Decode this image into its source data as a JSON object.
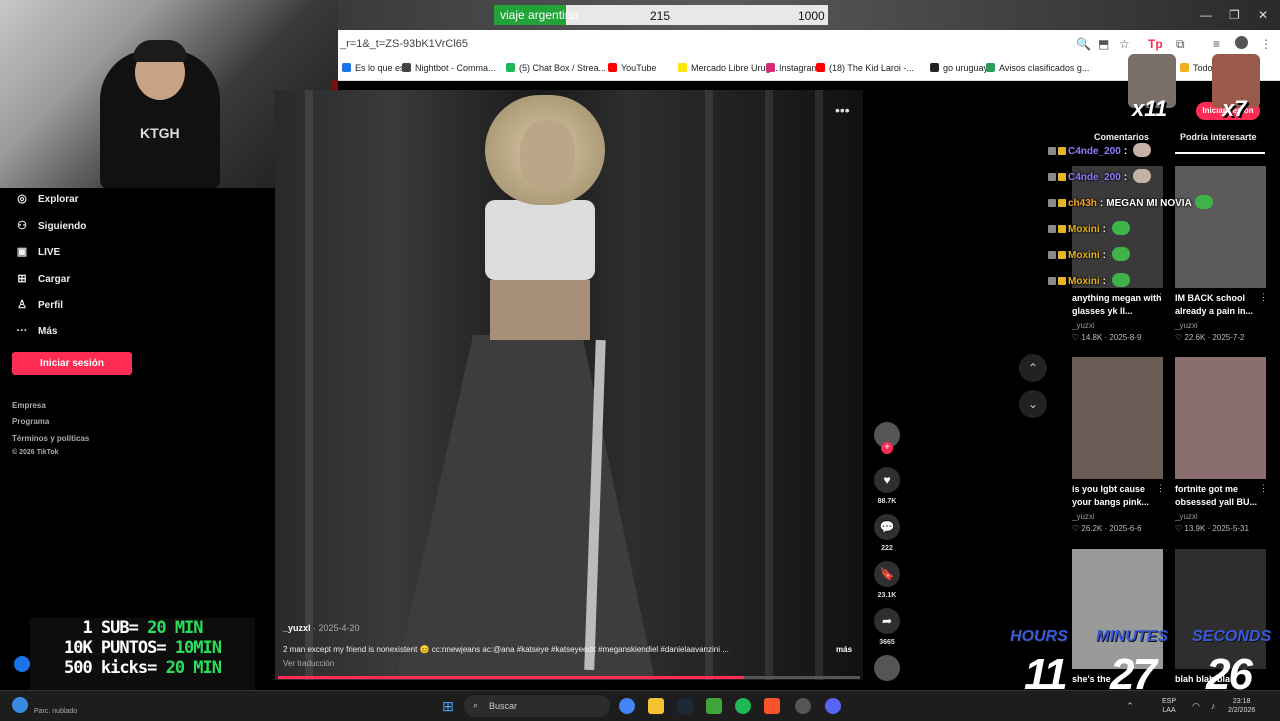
{
  "goal": {
    "label": "viaje argentina",
    "current": "215",
    "target": "1000",
    "progress": 0.215
  },
  "address": {
    "url": "_r=1&_t=ZS-93bK1VrCl65"
  },
  "bookmarks": [
    {
      "label": "Es lo que es...",
      "color": "#1a73e8"
    },
    {
      "label": "Nightbot - Comma...",
      "color": "#444"
    },
    {
      "label": "(5) Chat Box / Strea...",
      "color": "#1db954"
    },
    {
      "label": "YouTube",
      "color": "#ff0000"
    },
    {
      "label": "Mercado Libre Urug...",
      "color": "#ffe600"
    },
    {
      "label": "Instagram",
      "color": "#d62976"
    },
    {
      "label": "(18) The Kid Laroi -...",
      "color": "#ff0000"
    },
    {
      "label": "go uruguay",
      "color": "#222"
    },
    {
      "label": "Avisos clasificados g...",
      "color": "#2a9d5c"
    },
    {
      "label": "Todos",
      "color": "#f2b01e"
    }
  ],
  "sidebar": {
    "items": [
      {
        "label": "Explorar",
        "icon": "compass-icon"
      },
      {
        "label": "Siguiendo",
        "icon": "user-follow-icon"
      },
      {
        "label": "LIVE",
        "icon": "live-icon"
      },
      {
        "label": "Cargar",
        "icon": "upload-icon"
      },
      {
        "label": "Perfil",
        "icon": "profile-icon"
      },
      {
        "label": "Más",
        "icon": "more-icon"
      }
    ],
    "login": "Iniciar sesión",
    "footer": [
      "Empresa",
      "Programa",
      "Términos y políticas",
      "© 2026 TikTok"
    ]
  },
  "video": {
    "user": "_yuzxl",
    "date": "· 2025-4-20",
    "caption": "2 man except my friend is nonexistent 😊 cc:nnewjeans ac:@ana #katseye #katseyeedit #meganskiendiel #danielaavanzini ...",
    "more": "más",
    "translate": "Ver traducción",
    "progress": 0.8
  },
  "actions": {
    "likes": "88.7K",
    "comments": "222",
    "saves": "23.1K",
    "shares": "3665"
  },
  "right_panel": {
    "login": "Iniciar sesión",
    "tabs": [
      "Comentarios",
      "Podría interesarte"
    ],
    "cards": [
      {
        "caption": "anything megan with glasses yk ll...",
        "user": "_yuzxi",
        "likes": "♡ 14.8K",
        "date": "2025-8-9"
      },
      {
        "caption": "IM BACK school already a pain in...",
        "user": "_yuzxi",
        "likes": "♡ 22.6K",
        "date": "2025-7-2"
      },
      {
        "caption": "is you lgbt cause your bangs pink...",
        "user": "_yuzxi",
        "likes": "♡ 26.2K",
        "date": "2025-6-6"
      },
      {
        "caption": "fortnite got me obsessed yall BU...",
        "user": "_yuzxi",
        "likes": "♡ 13.9K",
        "date": "2025-5-31"
      },
      {
        "caption": "she's the",
        "user": "",
        "likes": "",
        "date": ""
      },
      {
        "caption": "blah blah bla",
        "user": "",
        "likes": "",
        "date": ""
      }
    ]
  },
  "chat": [
    {
      "user": "C4nde_200",
      "sep": ":",
      "msg": "",
      "color": "#8c7cff"
    },
    {
      "user": "C4nde_200",
      "sep": ":",
      "msg": "",
      "color": "#8c7cff"
    },
    {
      "user": "ch43h",
      "sep": ":",
      "msg": "MEGAN MI NOVIA",
      "color": "#f5a623"
    },
    {
      "user": "Moxini",
      "sep": ":",
      "msg": "",
      "color": "#e8b21e"
    },
    {
      "user": "Moxini",
      "sep": ":",
      "msg": "",
      "color": "#e8b21e"
    },
    {
      "user": "Moxini",
      "sep": ":",
      "msg": "",
      "color": "#e8b21e"
    }
  ],
  "overlay": {
    "rules": [
      {
        "a": "1 SUB= ",
        "b": "20 MIN"
      },
      {
        "a": "10K PUNTOS= ",
        "b": "10MIN"
      },
      {
        "a": "500 kicks= ",
        "b": "20 MIN"
      }
    ],
    "timer": {
      "hours_label": "HOURS",
      "minutes_label": "MINUTES",
      "seconds_label": "SECONDS",
      "hours": "11",
      "minutes": "27",
      "seconds": "26"
    },
    "mult1": "x11",
    "mult2": "x7"
  },
  "taskbar": {
    "weather": "Parc. nublado",
    "search": "Buscar",
    "lang": "ESP",
    "layout": "LAA",
    "time": "23:18",
    "date": "2/2/2026"
  }
}
